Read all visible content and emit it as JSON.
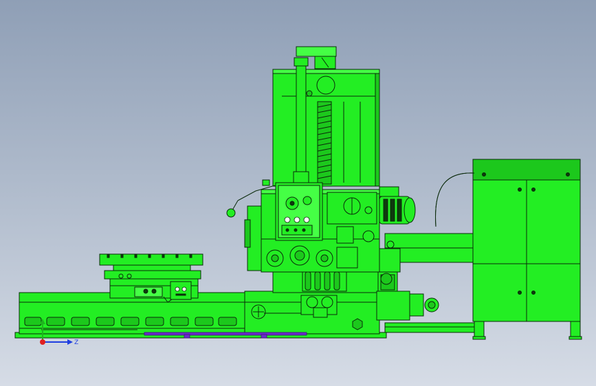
{
  "viewport": {
    "background_top": "#8f9fb6",
    "background_bottom": "#d6dce6",
    "model_color": "#23ee23",
    "edge_color": "#0a2a0a"
  },
  "triad": {
    "z_label": "Z",
    "z_color": "#1f3fe0",
    "y_color": "#1fb41f",
    "origin_color": "#e02020"
  }
}
